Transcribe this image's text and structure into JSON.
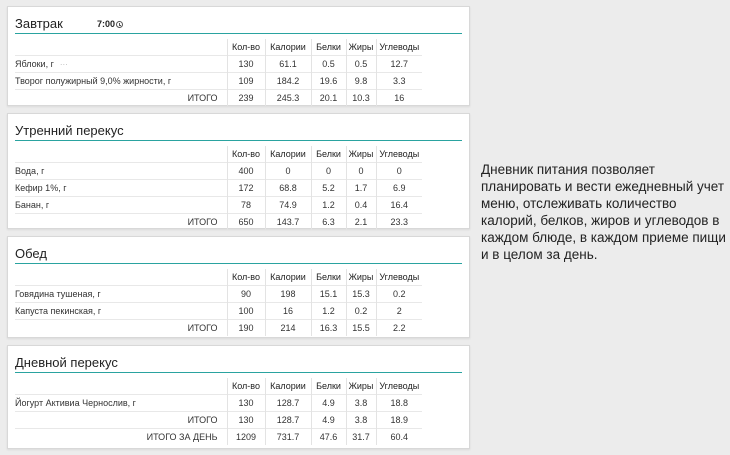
{
  "columns": [
    "Кол-во",
    "Калории",
    "Белки",
    "Жиры",
    "Углеводы"
  ],
  "meals": [
    {
      "title": "Завтрак",
      "time": "7:00",
      "items": [
        {
          "name": "Яблоки, г",
          "values": [
            "130",
            "61.1",
            "0.5",
            "0.5",
            "12.7"
          ],
          "more": true
        },
        {
          "name": "Творог полужирный 9,0% жирности, г",
          "values": [
            "109",
            "184.2",
            "19.6",
            "9.8",
            "3.3"
          ]
        }
      ],
      "total": {
        "label": "ИТОГО",
        "values": [
          "239",
          "245.3",
          "20.1",
          "10.3",
          "16"
        ]
      }
    },
    {
      "title": "Утренний перекус",
      "items": [
        {
          "name": "Вода, г",
          "values": [
            "400",
            "0",
            "0",
            "0",
            "0"
          ]
        },
        {
          "name": "Кефир 1%, г",
          "values": [
            "172",
            "68.8",
            "5.2",
            "1.7",
            "6.9"
          ]
        },
        {
          "name": "Банан, г",
          "values": [
            "78",
            "74.9",
            "1.2",
            "0.4",
            "16.4"
          ]
        }
      ],
      "total": {
        "label": "ИТОГО",
        "values": [
          "650",
          "143.7",
          "6.3",
          "2.1",
          "23.3"
        ]
      }
    },
    {
      "title": "Обед",
      "items": [
        {
          "name": "Говядина тушеная, г",
          "values": [
            "90",
            "198",
            "15.1",
            "15.3",
            "0.2"
          ]
        },
        {
          "name": "Капуста пекинская, г",
          "values": [
            "100",
            "16",
            "1.2",
            "0.2",
            "2"
          ]
        }
      ],
      "total": {
        "label": "ИТОГО",
        "values": [
          "190",
          "214",
          "16.3",
          "15.5",
          "2.2"
        ]
      }
    },
    {
      "title": "Дневной перекус",
      "items": [
        {
          "name": "Йогурт Активиа Чернослив, г",
          "values": [
            "130",
            "128.7",
            "4.9",
            "3.8",
            "18.8"
          ]
        }
      ],
      "total": {
        "label": "ИТОГО",
        "values": [
          "130",
          "128.7",
          "4.9",
          "3.8",
          "18.9"
        ]
      },
      "day_total": {
        "label": "ИТОГО ЗА ДЕНЬ",
        "values": [
          "1209",
          "731.7",
          "47.6",
          "31.7",
          "60.4"
        ]
      }
    }
  ],
  "more_icon": "···",
  "description": "Дневник питания позволяет планировать и вести ежедневный учет меню, отслеживать количество калорий, белков, жиров и углеводов в каждом блюде, в каждом приеме пищи и в целом за день."
}
